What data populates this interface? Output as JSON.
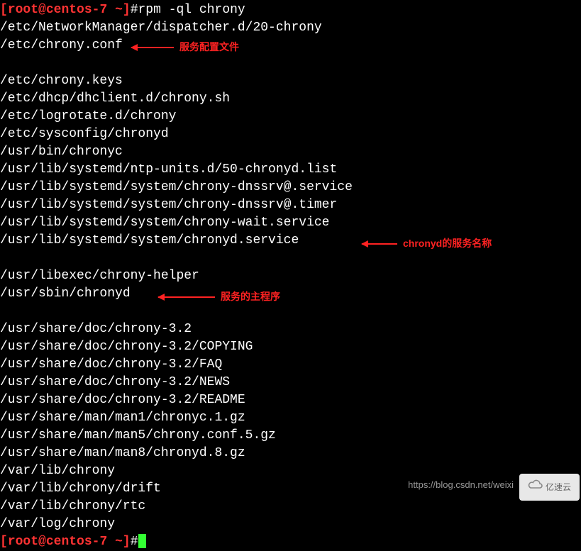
{
  "prompt1": {
    "open": "[",
    "user": "root",
    "at": "@",
    "host": "centos-7",
    "path": " ~",
    "close": "]",
    "hash": "#",
    "command": "rpm -ql chrony"
  },
  "files": [
    "/etc/NetworkManager/dispatcher.d/20-chrony",
    "/etc/chrony.conf",
    "/etc/chrony.keys",
    "/etc/dhcp/dhclient.d/chrony.sh",
    "/etc/logrotate.d/chrony",
    "/etc/sysconfig/chronyd",
    "/usr/bin/chronyc",
    "/usr/lib/systemd/ntp-units.d/50-chronyd.list",
    "/usr/lib/systemd/system/chrony-dnssrv@.service",
    "/usr/lib/systemd/system/chrony-dnssrv@.timer",
    "/usr/lib/systemd/system/chrony-wait.service",
    "/usr/lib/systemd/system/chronyd.service",
    "/usr/libexec/chrony-helper",
    "/usr/sbin/chronyd",
    "/usr/share/doc/chrony-3.2",
    "/usr/share/doc/chrony-3.2/COPYING",
    "/usr/share/doc/chrony-3.2/FAQ",
    "/usr/share/doc/chrony-3.2/NEWS",
    "/usr/share/doc/chrony-3.2/README",
    "/usr/share/man/man1/chronyc.1.gz",
    "/usr/share/man/man5/chrony.conf.5.gz",
    "/usr/share/man/man8/chronyd.8.gz",
    "/var/lib/chrony",
    "/var/lib/chrony/drift",
    "/var/lib/chrony/rtc",
    "/var/log/chrony"
  ],
  "prompt2": {
    "open": "[",
    "user": "root",
    "at": "@",
    "host": "centos-7",
    "path": " ~",
    "close": "]",
    "hash": "#"
  },
  "annotations": {
    "conf": "服务配置文件",
    "service": "chronyd的服务名称",
    "sbin": "服务的主程序"
  },
  "watermark": "https://blog.csdn.net/weixi",
  "logo": "亿速云"
}
